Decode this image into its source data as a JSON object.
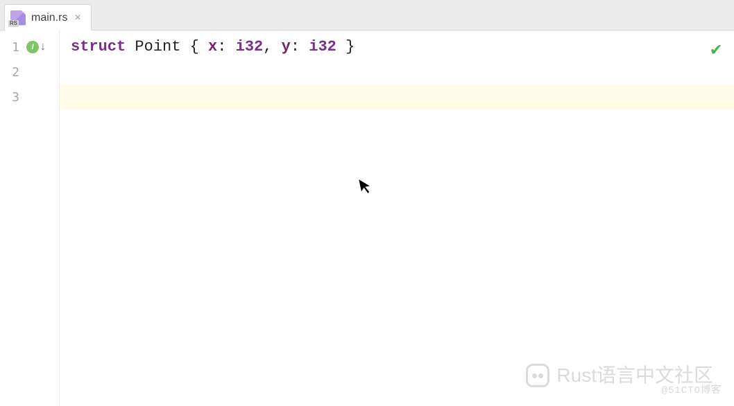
{
  "tab": {
    "filename": "main.rs",
    "file_ext_badge": "RS"
  },
  "gutter": {
    "lines": [
      "1",
      "2",
      "3"
    ],
    "impl_badge": "I"
  },
  "code": {
    "line1": {
      "kw": "struct",
      "name": " Point ",
      "open": "{ ",
      "f1": "x",
      "sep1": ": ",
      "t1": "i32",
      "comma": ", ",
      "f2": "y",
      "sep2": ": ",
      "t2": "i32",
      "close": " }"
    }
  },
  "watermarks": {
    "community": "Rust语言中文社区",
    "source": "@51CTO博客"
  }
}
